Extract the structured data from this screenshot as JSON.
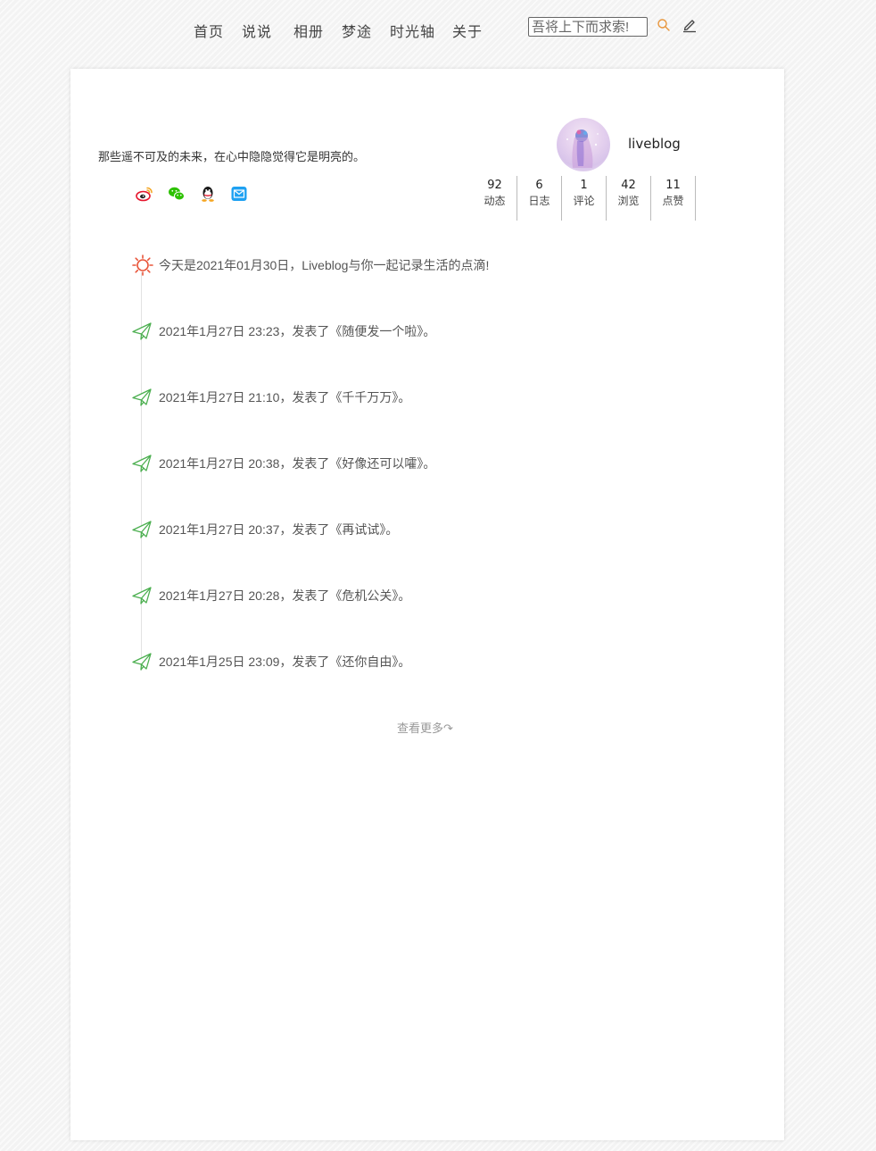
{
  "nav": {
    "items": [
      "首页",
      "说说",
      "相册",
      "梦途",
      "时光轴",
      "关于"
    ],
    "search_placeholder": "吾将上下而求索!"
  },
  "profile": {
    "motto": "那些遥不可及的未来，在心中隐隐觉得它是明亮的。",
    "username": "liveblog",
    "social_icons": [
      "weibo-icon",
      "wechat-icon",
      "qq-icon",
      "mail-icon"
    ],
    "stats": [
      {
        "value": "92",
        "label": "动态"
      },
      {
        "value": "6",
        "label": "日志"
      },
      {
        "value": "1",
        "label": "评论"
      },
      {
        "value": "42",
        "label": "浏览"
      },
      {
        "value": "11",
        "label": "点赞"
      }
    ]
  },
  "timeline": {
    "today": "今天是2021年01月30日，Liveblog与你一起记录生活的点滴!",
    "entries": [
      "2021年1月27日 23:23，发表了《随便发一个啦》。",
      "2021年1月27日 21:10，发表了《千千万万》。",
      "2021年1月27日 20:38，发表了《好像还可以嚯》。",
      "2021年1月27日 20:37，发表了《再试试》。",
      "2021年1月27日 20:28，发表了《危机公关》。",
      "2021年1月25日 23:09，发表了《还你自由》。"
    ],
    "more_label": "查看更多↷"
  },
  "colors": {
    "sun": "#e8553a",
    "plane": "#4caf50",
    "weibo": "#e6162d",
    "wechat": "#2dc100",
    "mail": "#1ea1f2",
    "search_icon": "#e8953a"
  }
}
